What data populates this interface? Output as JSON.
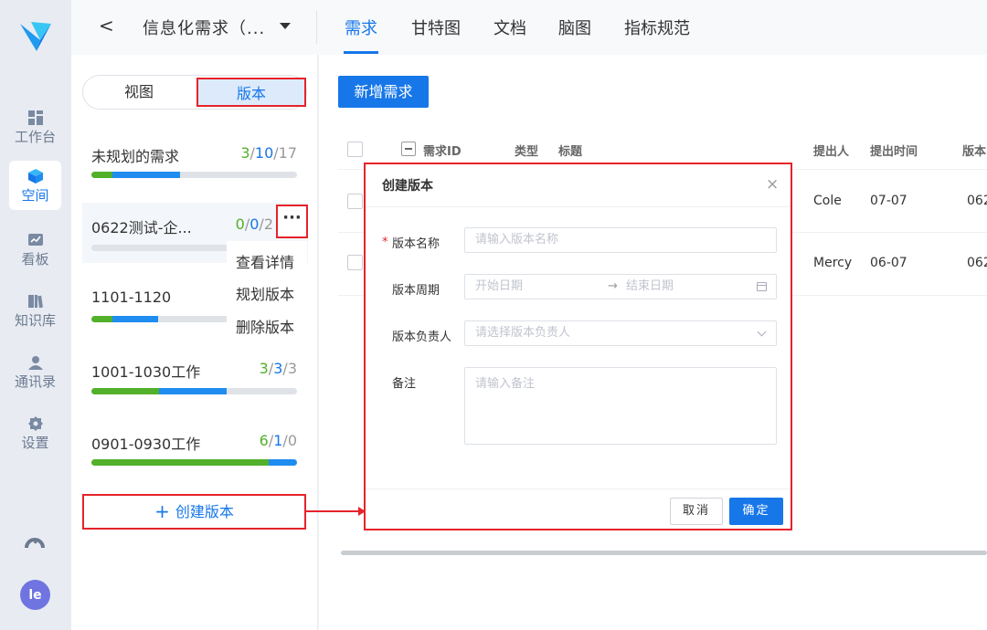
{
  "sidebar": {
    "items": [
      {
        "label": "工作台",
        "icon": "dashboard-icon"
      },
      {
        "label": "空间",
        "icon": "cube-icon",
        "active": true
      },
      {
        "label": "看板",
        "icon": "chart-board-icon"
      },
      {
        "label": "知识库",
        "icon": "book-icon"
      },
      {
        "label": "通讯录",
        "icon": "person-icon"
      },
      {
        "label": "设置",
        "icon": "gear-icon"
      }
    ],
    "avatar": "le"
  },
  "header": {
    "back_label": "<",
    "project_title": "信息化需求（...",
    "tabs": [
      {
        "label": "需求",
        "active": true
      },
      {
        "label": "甘特图"
      },
      {
        "label": "文档"
      },
      {
        "label": "脑图"
      },
      {
        "label": "指标规范"
      }
    ]
  },
  "version_panel": {
    "segment_view": "视图",
    "segment_version": "版本",
    "versions": [
      {
        "name": "未规划的需求",
        "done": "3",
        "in_progress": "10",
        "total": "17",
        "green_frac": 0.1,
        "blue_frac": 0.33
      },
      {
        "name": "0622测试-企...",
        "done": "0",
        "in_progress": "0",
        "total": "2",
        "green_frac": 0,
        "blue_frac": 0
      },
      {
        "name": "1101-1120",
        "green_frac": 0.1,
        "blue_frac": 0.22
      },
      {
        "name": "1001-1030工作",
        "done": "3",
        "in_progress": "3",
        "total": "3",
        "green_frac": 0.33,
        "blue_frac": 0.33
      },
      {
        "name": "0901-0930工作",
        "done": "6",
        "in_progress": "1",
        "total": "0",
        "green_frac": 0.86,
        "blue_frac": 0.14
      }
    ],
    "more_label": "···",
    "context_menu": [
      "查看详情",
      "规划版本",
      "删除版本"
    ],
    "create_label": "创建版本",
    "create_plus": "+"
  },
  "main": {
    "add_button": "新增需求",
    "columns": [
      "需求ID",
      "类型",
      "标题",
      "提出人",
      "提出时间",
      "版本"
    ],
    "rows": [
      {
        "proposer": "Cole",
        "date": "07-07",
        "version": "062"
      },
      {
        "proposer": "Mercy",
        "date": "06-07",
        "version": "062"
      }
    ]
  },
  "modal": {
    "title": "创建版本",
    "close": "×",
    "required_mark": "*",
    "fields": {
      "name_label": "版本名称",
      "name_placeholder": "请输入版本名称",
      "period_label": "版本周期",
      "start_placeholder": "开始日期",
      "range_arrow": "→",
      "end_placeholder": "结束日期",
      "owner_label": "版本负责人",
      "owner_placeholder": "请选择版本负责人",
      "note_label": "备注",
      "note_placeholder": "请输入备注"
    },
    "cancel": "取消",
    "confirm": "确定"
  },
  "colors": {
    "accent": "#1777e9",
    "success": "#52b02a",
    "highlight_border": "#e5232a"
  }
}
